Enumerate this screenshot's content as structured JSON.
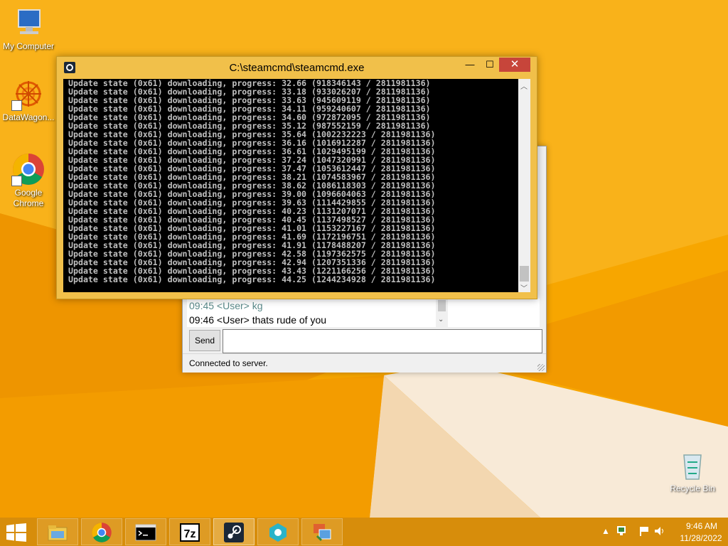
{
  "desktop": {
    "icons": [
      {
        "label": "My Computer"
      },
      {
        "label": "DataWagon..."
      },
      {
        "label": "Google Chrome"
      },
      {
        "label": "Recycle Bin"
      }
    ]
  },
  "chat_window": {
    "messages": [
      "09:45 <User> kg",
      "09:46 <User> thats rude of you"
    ],
    "send_label": "Send",
    "input_value": "",
    "status": "Connected to server."
  },
  "cmd_window": {
    "title": "C:\\steamcmd\\steamcmd.exe",
    "minimize_glyph": "—",
    "maximize_glyph": "☐",
    "close_glyph": "✕",
    "lines": [
      "Update state (0x61) downloading, progress: 32.66 (918346143 / 2811981136)",
      "Update state (0x61) downloading, progress: 33.18 (933026207 / 2811981136)",
      "Update state (0x61) downloading, progress: 33.63 (945609119 / 2811981136)",
      "Update state (0x61) downloading, progress: 34.11 (959240607 / 2811981136)",
      "Update state (0x61) downloading, progress: 34.60 (972872095 / 2811981136)",
      "Update state (0x61) downloading, progress: 35.12 (987552159 / 2811981136)",
      "Update state (0x61) downloading, progress: 35.64 (1002232223 / 2811981136)",
      "Update state (0x61) downloading, progress: 36.16 (1016912287 / 2811981136)",
      "Update state (0x61) downloading, progress: 36.61 (1029495199 / 2811981136)",
      "Update state (0x61) downloading, progress: 37.24 (1047320991 / 2811981136)",
      "Update state (0x61) downloading, progress: 37.47 (1053612447 / 2811981136)",
      "Update state (0x61) downloading, progress: 38.21 (1074583967 / 2811981136)",
      "Update state (0x61) downloading, progress: 38.62 (1086118303 / 2811981136)",
      "Update state (0x61) downloading, progress: 39.00 (1096604063 / 2811981136)",
      "Update state (0x61) downloading, progress: 39.63 (1114429855 / 2811981136)",
      "Update state (0x61) downloading, progress: 40.23 (1131207071 / 2811981136)",
      "Update state (0x61) downloading, progress: 40.45 (1137498527 / 2811981136)",
      "Update state (0x61) downloading, progress: 41.01 (1153227167 / 2811981136)",
      "Update state (0x61) downloading, progress: 41.69 (1172196751 / 2811981136)",
      "Update state (0x61) downloading, progress: 41.91 (1178488207 / 2811981136)",
      "Update state (0x61) downloading, progress: 42.58 (1197362575 / 2811981136)",
      "Update state (0x61) downloading, progress: 42.94 (1207351336 / 2811981136)",
      "Update state (0x61) downloading, progress: 43.43 (1221166256 / 2811981136)",
      "Update state (0x61) downloading, progress: 44.25 (1244234928 / 2811981136)"
    ]
  },
  "taskbar": {
    "apps": [
      {
        "name": "file-explorer-icon"
      },
      {
        "name": "chrome-icon"
      },
      {
        "name": "command-prompt-icon"
      },
      {
        "name": "7zip-icon",
        "text": "7z"
      },
      {
        "name": "steam-icon"
      },
      {
        "name": "bluestack-icon"
      },
      {
        "name": "remote-desktop-icon"
      }
    ],
    "clock": {
      "time": "9:46 AM",
      "date": "11/28/2022"
    }
  },
  "colors": {
    "wallpaper": "#f5a000",
    "cmd_frame": "#f1c04a",
    "close_button": "#c7453a",
    "console_text": "#c0c0c0"
  }
}
